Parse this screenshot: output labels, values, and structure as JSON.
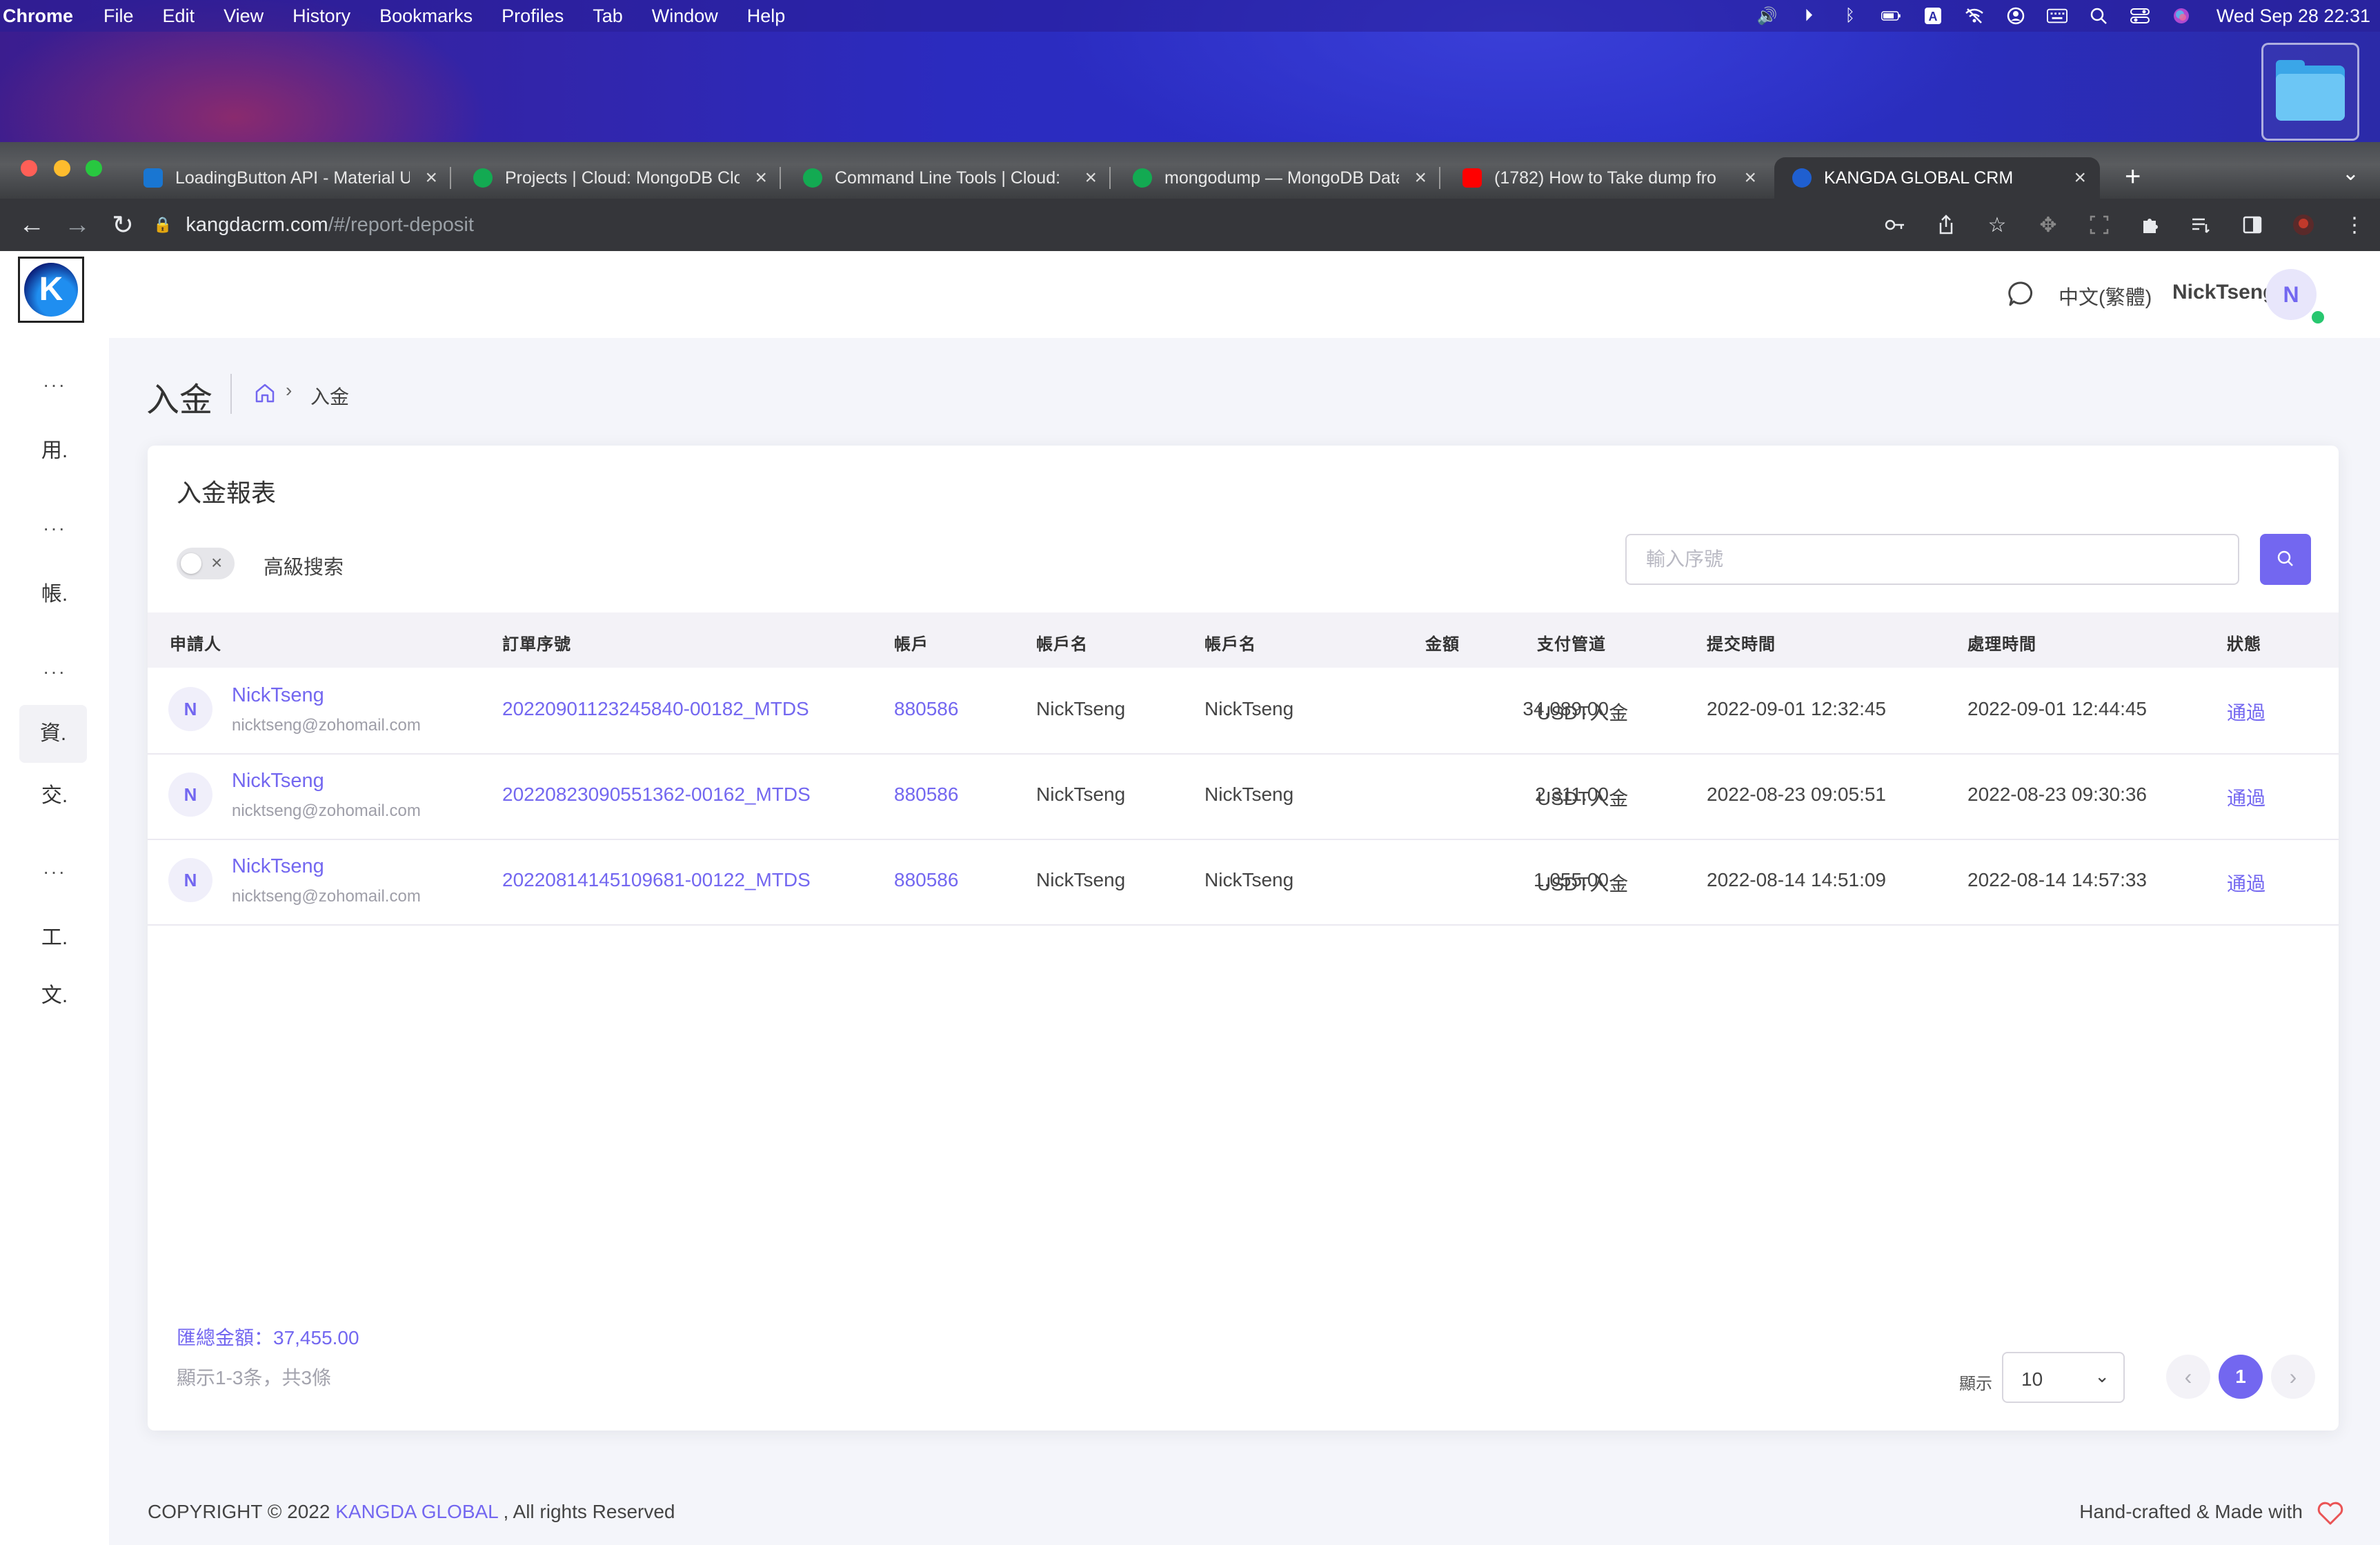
{
  "menubar": {
    "app": "Chrome",
    "items": [
      "File",
      "Edit",
      "View",
      "History",
      "Bookmarks",
      "Profiles",
      "Tab",
      "Window",
      "Help"
    ],
    "clock": "Wed Sep 28  22:31"
  },
  "browser": {
    "tabs": [
      {
        "title": "LoadingButton API - Material U",
        "favicon": "mui-icon"
      },
      {
        "title": "Projects | Cloud: MongoDB Clo",
        "favicon": "mongodb-leaf-icon"
      },
      {
        "title": "Command Line Tools | Cloud:",
        "favicon": "mongodb-leaf-icon"
      },
      {
        "title": "mongodump — MongoDB Data",
        "favicon": "mongodb-leaf-icon"
      },
      {
        "title": "(1782) How to Take dump fro",
        "favicon": "youtube-icon"
      },
      {
        "title": "KANGDA GLOBAL CRM",
        "favicon": "kangda-icon"
      }
    ],
    "url_host": "kangdacrm.com",
    "url_path": "/#/report-deposit"
  },
  "app": {
    "logo_letter": "K",
    "sidebar": [
      {
        "type": "dots",
        "label": "···"
      },
      {
        "type": "item",
        "label": "用."
      },
      {
        "type": "dots",
        "label": "···"
      },
      {
        "type": "item",
        "label": "帳."
      },
      {
        "type": "dots",
        "label": "···"
      },
      {
        "type": "item",
        "label": "資."
      },
      {
        "type": "item",
        "label": "交."
      },
      {
        "type": "dots",
        "label": "···"
      },
      {
        "type": "item",
        "label": "工."
      },
      {
        "type": "item",
        "label": "文."
      }
    ],
    "topbar": {
      "language": "中文(繁體)",
      "username": "NickTseng",
      "avatar_letter": "N"
    },
    "page_title": "入金",
    "breadcrumb_current": "入金",
    "card_title": "入金報表",
    "advanced_search_label": "高級搜索",
    "search_placeholder": "輸入序號",
    "table": {
      "headers": [
        "申請人",
        "訂單序號",
        "帳戶",
        "帳戶名",
        "帳戶名",
        "金額",
        "支付管道",
        "提交時間",
        "處理時間",
        "狀態"
      ],
      "rows": [
        {
          "avatar": "N",
          "name": "NickTseng",
          "email": "nicktseng@zohomail.com",
          "order": "20220901123245840-00182_MTDS",
          "account": "880586",
          "account_name_1": "NickTseng",
          "account_name_2": "NickTseng",
          "amount": "34,089.00",
          "channel": "USDT入金",
          "submitted": "2022-09-01 12:32:45",
          "processed": "2022-09-01 12:44:45",
          "status": "通過"
        },
        {
          "avatar": "N",
          "name": "NickTseng",
          "email": "nicktseng@zohomail.com",
          "order": "20220823090551362-00162_MTDS",
          "account": "880586",
          "account_name_1": "NickTseng",
          "account_name_2": "NickTseng",
          "amount": "2,311.00",
          "channel": "USDT入金",
          "submitted": "2022-08-23 09:05:51",
          "processed": "2022-08-23 09:30:36",
          "status": "通過"
        },
        {
          "avatar": "N",
          "name": "NickTseng",
          "email": "nicktseng@zohomail.com",
          "order": "20220814145109681-00122_MTDS",
          "account": "880586",
          "account_name_1": "NickTseng",
          "account_name_2": "NickTseng",
          "amount": "1,055.00",
          "channel": "USDT入金",
          "submitted": "2022-08-14 14:51:09",
          "processed": "2022-08-14 14:57:33",
          "status": "通過"
        }
      ]
    },
    "total_amount": "匯總金額：37,455.00",
    "showing": "顯示1-3条，共3條",
    "per_page_label": "顯示",
    "per_page_value": "10",
    "current_page": "1",
    "footer": {
      "copyright_prefix": "COPYRIGHT © 2022",
      "brand": "KANGDA GLOBAL",
      "copyright_suffix": ", All rights Reserved",
      "made_with": "Hand-crafted & Made with"
    }
  },
  "colors": {
    "accent": "#7367f0",
    "success": "#28c76f"
  }
}
